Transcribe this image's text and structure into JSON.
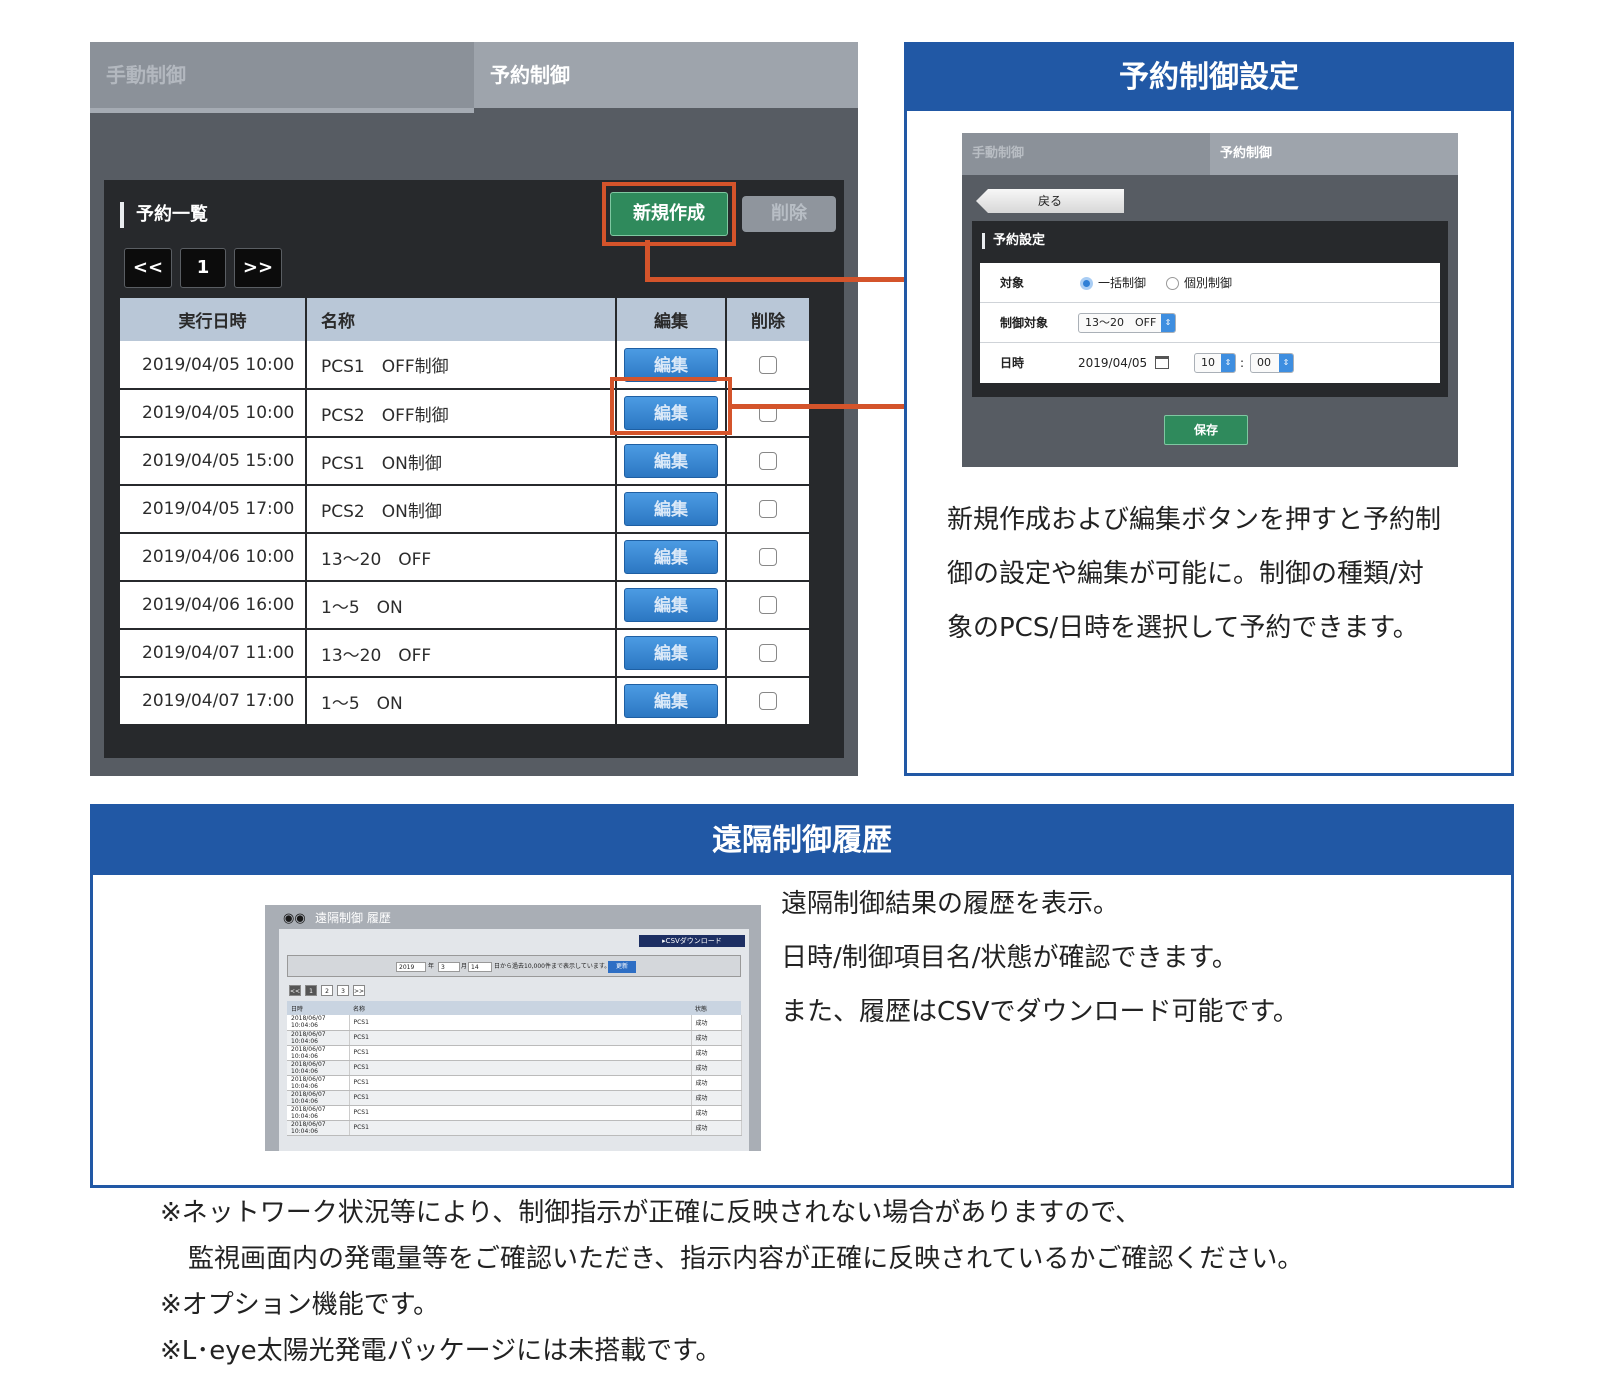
{
  "left": {
    "tabs": [
      "手動制御",
      "予約制御"
    ],
    "list_title": "予約一覧",
    "new_button": "新規作成",
    "delete_button": "削除",
    "pagination": [
      "<<",
      "1",
      ">>"
    ],
    "columns": [
      "実行日時",
      "名称",
      "編集",
      "削除"
    ],
    "edit_label": "編集",
    "rows": [
      {
        "date": "2019/04/05 10:00",
        "name": "PCS1　OFF制御"
      },
      {
        "date": "2019/04/05 10:00",
        "name": "PCS2　OFF制御"
      },
      {
        "date": "2019/04/05 15:00",
        "name": "PCS1　ON制御"
      },
      {
        "date": "2019/04/05 17:00",
        "name": "PCS2　ON制御"
      },
      {
        "date": "2019/04/06 10:00",
        "name": "13〜20　OFF"
      },
      {
        "date": "2019/04/06 16:00",
        "name": "1〜5　ON"
      },
      {
        "date": "2019/04/07 11:00",
        "name": "13〜20　OFF"
      },
      {
        "date": "2019/04/07 17:00",
        "name": "1〜5　ON"
      }
    ]
  },
  "right": {
    "header": "予約制御設定",
    "tabs": [
      "手動制御",
      "予約制御"
    ],
    "back_button": "戻る",
    "settings_title": "予約設定",
    "target_label": "対象",
    "radio_options": [
      "一括制御",
      "個別制御"
    ],
    "control_target_label": "制御対象",
    "control_target_value": "13〜20　OFF",
    "datetime_label": "日時",
    "date_value": "2019/04/05",
    "hour_value": "10",
    "minute_value": "00",
    "save_button": "保存",
    "description": [
      "新規作成および編集ボタンを押すと予約制",
      "御の設定や編集が可能に。制御の種類/対",
      "象のPCS/日時を選択して予約できます。"
    ]
  },
  "bottom": {
    "header": "遠隔制御履歴",
    "screenshot": {
      "title": "遠隔制御 履歴",
      "csv_button": "▸CSVダウンロード",
      "year": "2019",
      "year_suffix": "年",
      "month": "3",
      "month_suffix": "月",
      "day": "14",
      "filter_note": "日から過去10,000件まで表示しています。",
      "refresh_button": "更新",
      "pagination": [
        "<<",
        "1",
        "2",
        "3",
        ">>"
      ],
      "columns": [
        "日時",
        "名称",
        "状態"
      ],
      "rows": [
        {
          "date": "2018/06/07 10:04:06",
          "name": "PCS1",
          "status": "成功"
        },
        {
          "date": "2018/06/07 10:04:06",
          "name": "PCS1",
          "status": "成功"
        },
        {
          "date": "2018/06/07 10:04:06",
          "name": "PCS1",
          "status": "成功"
        },
        {
          "date": "2018/06/07 10:04:06",
          "name": "PCS1",
          "status": "成功"
        },
        {
          "date": "2018/06/07 10:04:06",
          "name": "PCS1",
          "status": "成功"
        },
        {
          "date": "2018/06/07 10:04:06",
          "name": "PCS1",
          "status": "成功"
        },
        {
          "date": "2018/06/07 10:04:06",
          "name": "PCS1",
          "status": "成功"
        },
        {
          "date": "2018/06/07 10:04:06",
          "name": "PCS1",
          "status": "成功"
        }
      ]
    },
    "description": [
      "遠隔制御結果の履歴を表示。",
      "日時/制御項目名/状態が確認できます。",
      "また、履歴はCSVでダウンロード可能です。"
    ]
  },
  "notes": [
    "※ネットワーク状況等により、制御指示が正確に反映されない場合がありますので、",
    "監視画面内の発電量等をご確認いただき、指示内容が正確に反映されているかご確認ください。",
    "※オプション機能です。",
    "※L･eye太陽光発電パッケージには未搭載です。"
  ],
  "colors": {
    "accent_blue": "#2158a5",
    "highlight_orange": "#d4542b",
    "new_button_green": "#2f8a5c",
    "edit_button_blue": "#2c77c2"
  }
}
